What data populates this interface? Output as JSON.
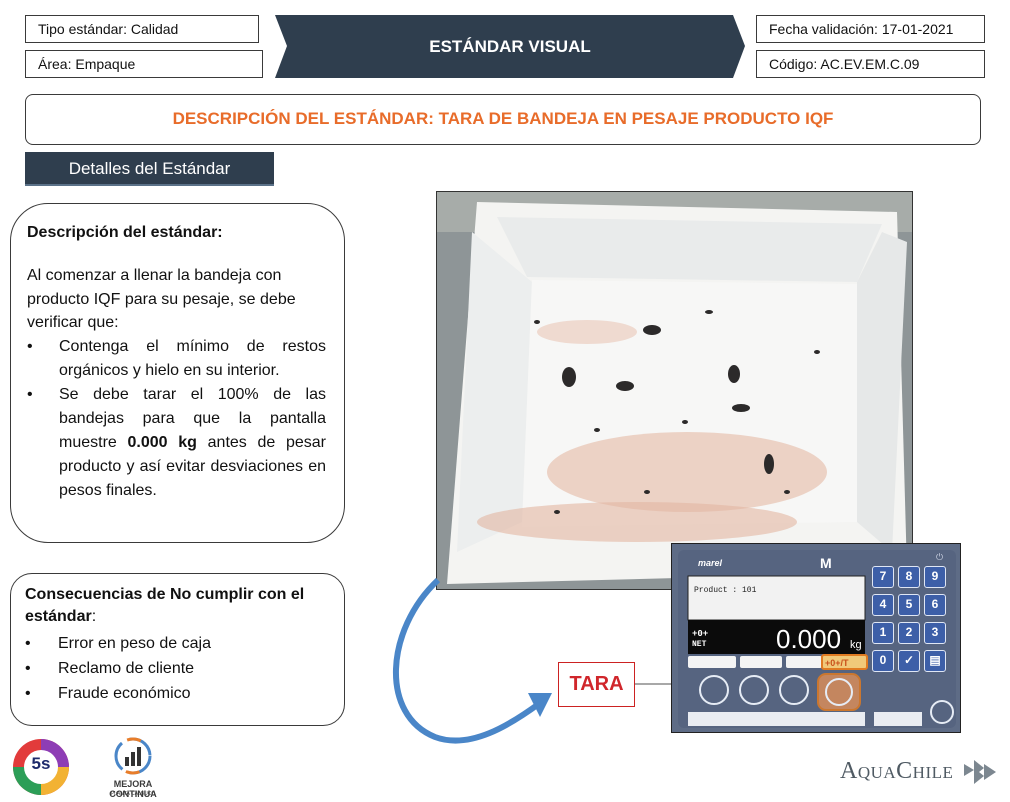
{
  "header": {
    "tipo_estandar": "Tipo estándar: Calidad",
    "area": "Área: Empaque",
    "banner_title": "ESTÁNDAR VISUAL",
    "fecha_validacion": "Fecha validación: 17-01-2021",
    "codigo": "Código: AC.EV.EM.C.09"
  },
  "title": "DESCRIPCIÓN DEL ESTÁNDAR: TARA DE BANDEJA EN PESAJE PRODUCTO IQF",
  "details_tab": "Detalles del Estándar",
  "description": {
    "heading": "Descripción del estándar:",
    "intro": "Al comenzar a llenar la bandeja con producto IQF para su pesaje, se debe verificar que:",
    "bullet1": "Contenga el mínimo de restos orgánicos y hielo en su interior.",
    "bullet2_pre": "Se debe tarar el 100% de las bandejas para que la pantalla muestre ",
    "bullet2_bold": "0.000 kg",
    "bullet2_post": " antes de pesar producto y así evitar desviaciones en pesos finales."
  },
  "consequences": {
    "heading": "Consecuencias de No cumplir con el estándar",
    "heading_suffix": ":",
    "items": [
      "Error en peso de caja",
      "Reclamo de cliente",
      "Fraude económico"
    ]
  },
  "scale": {
    "brand": "marel",
    "product_line": "Product  :  101",
    "reading": "0.000",
    "unit": "kg",
    "net_label": "NET",
    "keys": [
      "7",
      "8",
      "9",
      "4",
      "5",
      "6",
      "1",
      "2",
      "3",
      "0",
      "✓",
      "▤"
    ],
    "tare_key": "+0+/T"
  },
  "callout": "TARA",
  "logos": {
    "fives": "5s",
    "mejora": "MEJORA CONTINUA",
    "mejora_sub": "PLANTA CALBUCO",
    "brand": "AquaChile"
  },
  "colors": {
    "banner": "#2f3e4e",
    "title_orange": "#e86c2a",
    "callout_red": "#d0262b",
    "arrow_blue": "#4a86c8"
  }
}
